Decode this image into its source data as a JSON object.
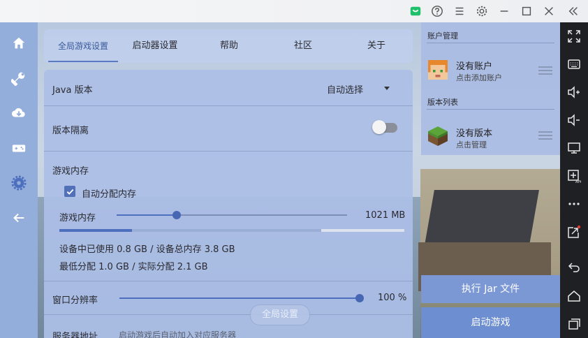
{
  "titlebar": {
    "icons": [
      "store-icon",
      "help-icon",
      "menu-icon",
      "settings-icon",
      "minimize-icon",
      "maximize-icon",
      "close-icon",
      "collapse-icon"
    ]
  },
  "leftnav": {
    "items": [
      "home-icon",
      "wrench-icon",
      "download-icon",
      "gamepad-icon",
      "settings-icon",
      "back-arrow-icon"
    ]
  },
  "tabs": [
    {
      "label": "全局游戏设置",
      "active": true
    },
    {
      "label": "启动器设置",
      "active": false
    },
    {
      "label": "帮助",
      "active": false
    },
    {
      "label": "社区",
      "active": false
    },
    {
      "label": "关于",
      "active": false
    }
  ],
  "settings": {
    "java_label": "Java 版本",
    "java_value": "自动选择",
    "isolation_label": "版本隔离",
    "isolation_on": false,
    "memory_section": "游戏内存",
    "auto_alloc_label": "自动分配内存",
    "auto_alloc_checked": true,
    "memory_slider_label": "游戏内存",
    "memory_value": "1021 MB",
    "memory_used_fraction": 0.21,
    "memory_alloc_fraction": 0.55,
    "memory_slider_fraction": 0.26,
    "device_usage": "设备中已使用 0.8 GB / 设备总内存 3.8 GB",
    "alloc_info": "最低分配 1.0 GB / 实际分配 2.1 GB",
    "resolution_label": "窗口分辨率",
    "resolution_value": "100 %",
    "resolution_fraction": 1.0,
    "server_label": "服务器地址",
    "server_hint": "启动游戏后自动加入对应服务器",
    "floating_button": "全局设置"
  },
  "account": {
    "section_title": "账户管理",
    "name": "没有账户",
    "sub": "点击添加账户"
  },
  "versions": {
    "section_title": "版本列表",
    "name": "没有版本",
    "sub": "点击管理"
  },
  "actions": {
    "run_jar": "执行 Jar 文件",
    "launch": "启动游戏"
  },
  "emulator_toolbar": {
    "icons": [
      "fullscreen-icon",
      "keyboard-icon",
      "volume-up-icon",
      "volume-down-icon",
      "screen-icon",
      "apk-install-icon",
      "more-icon",
      "share-icon",
      "back-icon",
      "home-icon",
      "recent-apps-icon"
    ]
  },
  "colors": {
    "accent": "#5a7bc2",
    "panel": "#acbee6",
    "launch_button": "#6d8ed0",
    "toolbar": "#1f2023"
  }
}
